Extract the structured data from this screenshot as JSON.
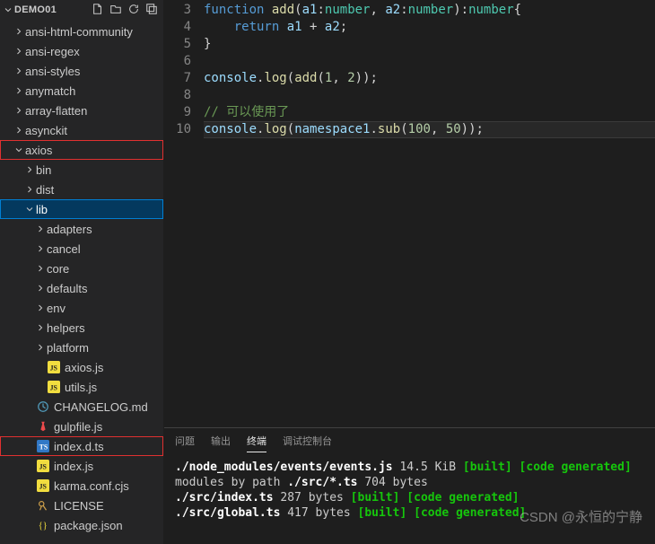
{
  "sidebar": {
    "title": "DEMO01",
    "items": [
      {
        "label": "ansi-html-community",
        "chev": "right",
        "lvl": "lvl1",
        "icon": "folder"
      },
      {
        "label": "ansi-regex",
        "chev": "right",
        "lvl": "lvl1",
        "icon": "folder"
      },
      {
        "label": "ansi-styles",
        "chev": "right",
        "lvl": "lvl1",
        "icon": "folder"
      },
      {
        "label": "anymatch",
        "chev": "right",
        "lvl": "lvl1",
        "icon": "folder"
      },
      {
        "label": "array-flatten",
        "chev": "right",
        "lvl": "lvl1",
        "icon": "folder"
      },
      {
        "label": "asynckit",
        "chev": "right",
        "lvl": "lvl1",
        "icon": "folder"
      },
      {
        "label": "axios",
        "chev": "down",
        "lvl": "lvl1",
        "icon": "folder",
        "red": true
      },
      {
        "label": "bin",
        "chev": "right",
        "lvl": "lvl2",
        "icon": "folder"
      },
      {
        "label": "dist",
        "chev": "right",
        "lvl": "lvl2",
        "icon": "folder"
      },
      {
        "label": "lib",
        "chev": "down",
        "lvl": "lvl2",
        "icon": "folder",
        "selected": true
      },
      {
        "label": "adapters",
        "chev": "right",
        "lvl": "lvl3",
        "icon": "folder"
      },
      {
        "label": "cancel",
        "chev": "right",
        "lvl": "lvl3",
        "icon": "folder"
      },
      {
        "label": "core",
        "chev": "right",
        "lvl": "lvl3",
        "icon": "folder"
      },
      {
        "label": "defaults",
        "chev": "right",
        "lvl": "lvl3",
        "icon": "folder"
      },
      {
        "label": "env",
        "chev": "right",
        "lvl": "lvl3",
        "icon": "folder"
      },
      {
        "label": "helpers",
        "chev": "right",
        "lvl": "lvl3",
        "icon": "folder"
      },
      {
        "label": "platform",
        "chev": "right",
        "lvl": "lvl3",
        "icon": "folder"
      },
      {
        "label": "axios.js",
        "chev": "",
        "lvl": "lvl3",
        "icon": "js"
      },
      {
        "label": "utils.js",
        "chev": "",
        "lvl": "lvl3",
        "icon": "js"
      },
      {
        "label": "CHANGELOG.md",
        "chev": "",
        "lvl": "lvl2",
        "icon": "md"
      },
      {
        "label": "gulpfile.js",
        "chev": "",
        "lvl": "lvl2",
        "icon": "gulp"
      },
      {
        "label": "index.d.ts",
        "chev": "",
        "lvl": "lvl2",
        "icon": "ts",
        "red": true
      },
      {
        "label": "index.js",
        "chev": "",
        "lvl": "lvl2",
        "icon": "js"
      },
      {
        "label": "karma.conf.cjs",
        "chev": "",
        "lvl": "lvl2",
        "icon": "js"
      },
      {
        "label": "LICENSE",
        "chev": "",
        "lvl": "lvl2",
        "icon": "lic"
      },
      {
        "label": "package.json",
        "chev": "",
        "lvl": "lvl2",
        "icon": "json"
      }
    ]
  },
  "editor": {
    "startLine": 3,
    "lines": [
      {
        "n": 3,
        "html": "<span class='kw'>function</span> <span class='fn'>add</span><span class='pl'>(</span><span class='id'>a1</span><span class='pl'>:</span><span class='typ'>number</span><span class='pl'>, </span><span class='id'>a2</span><span class='pl'>:</span><span class='typ'>number</span><span class='pl'>):</span><span class='typ'>number</span><span class='pl'>{</span>"
      },
      {
        "n": 4,
        "html": "    <span class='kw'>return</span> <span class='id'>a1</span> <span class='pl'>+</span> <span class='id'>a2</span><span class='pl'>;</span>"
      },
      {
        "n": 5,
        "html": "<span class='pl'>}</span>"
      },
      {
        "n": 6,
        "html": ""
      },
      {
        "n": 7,
        "html": "<span class='obj'>console</span><span class='pl'>.</span><span class='fn'>log</span><span class='pl'>(</span><span class='fn'>add</span><span class='pl'>(</span><span class='num'>1</span><span class='pl'>, </span><span class='num'>2</span><span class='pl'>));</span>"
      },
      {
        "n": 8,
        "html": ""
      },
      {
        "n": 9,
        "html": "<span class='cm'>// 可以使用了</span>"
      },
      {
        "n": 10,
        "html": "<span class='obj'>console</span><span class='pl'>.</span><span class='fn'>log</span><span class='pl'>(</span><span class='obj'>namespace1</span><span class='pl'>.</span><span class='fn'>sub</span><span class='pl'>(</span><span class='num'>100</span><span class='pl'>, </span><span class='num'>50</span><span class='pl'>));</span>",
        "hl": true
      }
    ]
  },
  "panel": {
    "tabs": {
      "problems": "问题",
      "output": "输出",
      "terminal": "终端",
      "debug": "调试控制台"
    },
    "lines": [
      {
        "html": "  <span class='tbold'>./node_modules/events/events.js</span> 14.5 KiB <span class='tgreen'>[built]</span> <span class='tgreen'>[code generated]</span>"
      },
      {
        "html": "modules by path <span class='tbold'>./src/*.ts</span> 704 bytes"
      },
      {
        "html": "  <span class='tbold'>./src/index.ts</span> 287 bytes <span class='tgreen'>[built]</span> <span class='tgreen'>[code generated]</span>"
      },
      {
        "html": "  <span class='tbold'>./src/global.ts</span> 417 bytes <span class='tgreen'>[built]</span> <span class='tgreen'>[code generated]</span>"
      }
    ]
  },
  "watermark": "CSDN @永恒的宁静"
}
